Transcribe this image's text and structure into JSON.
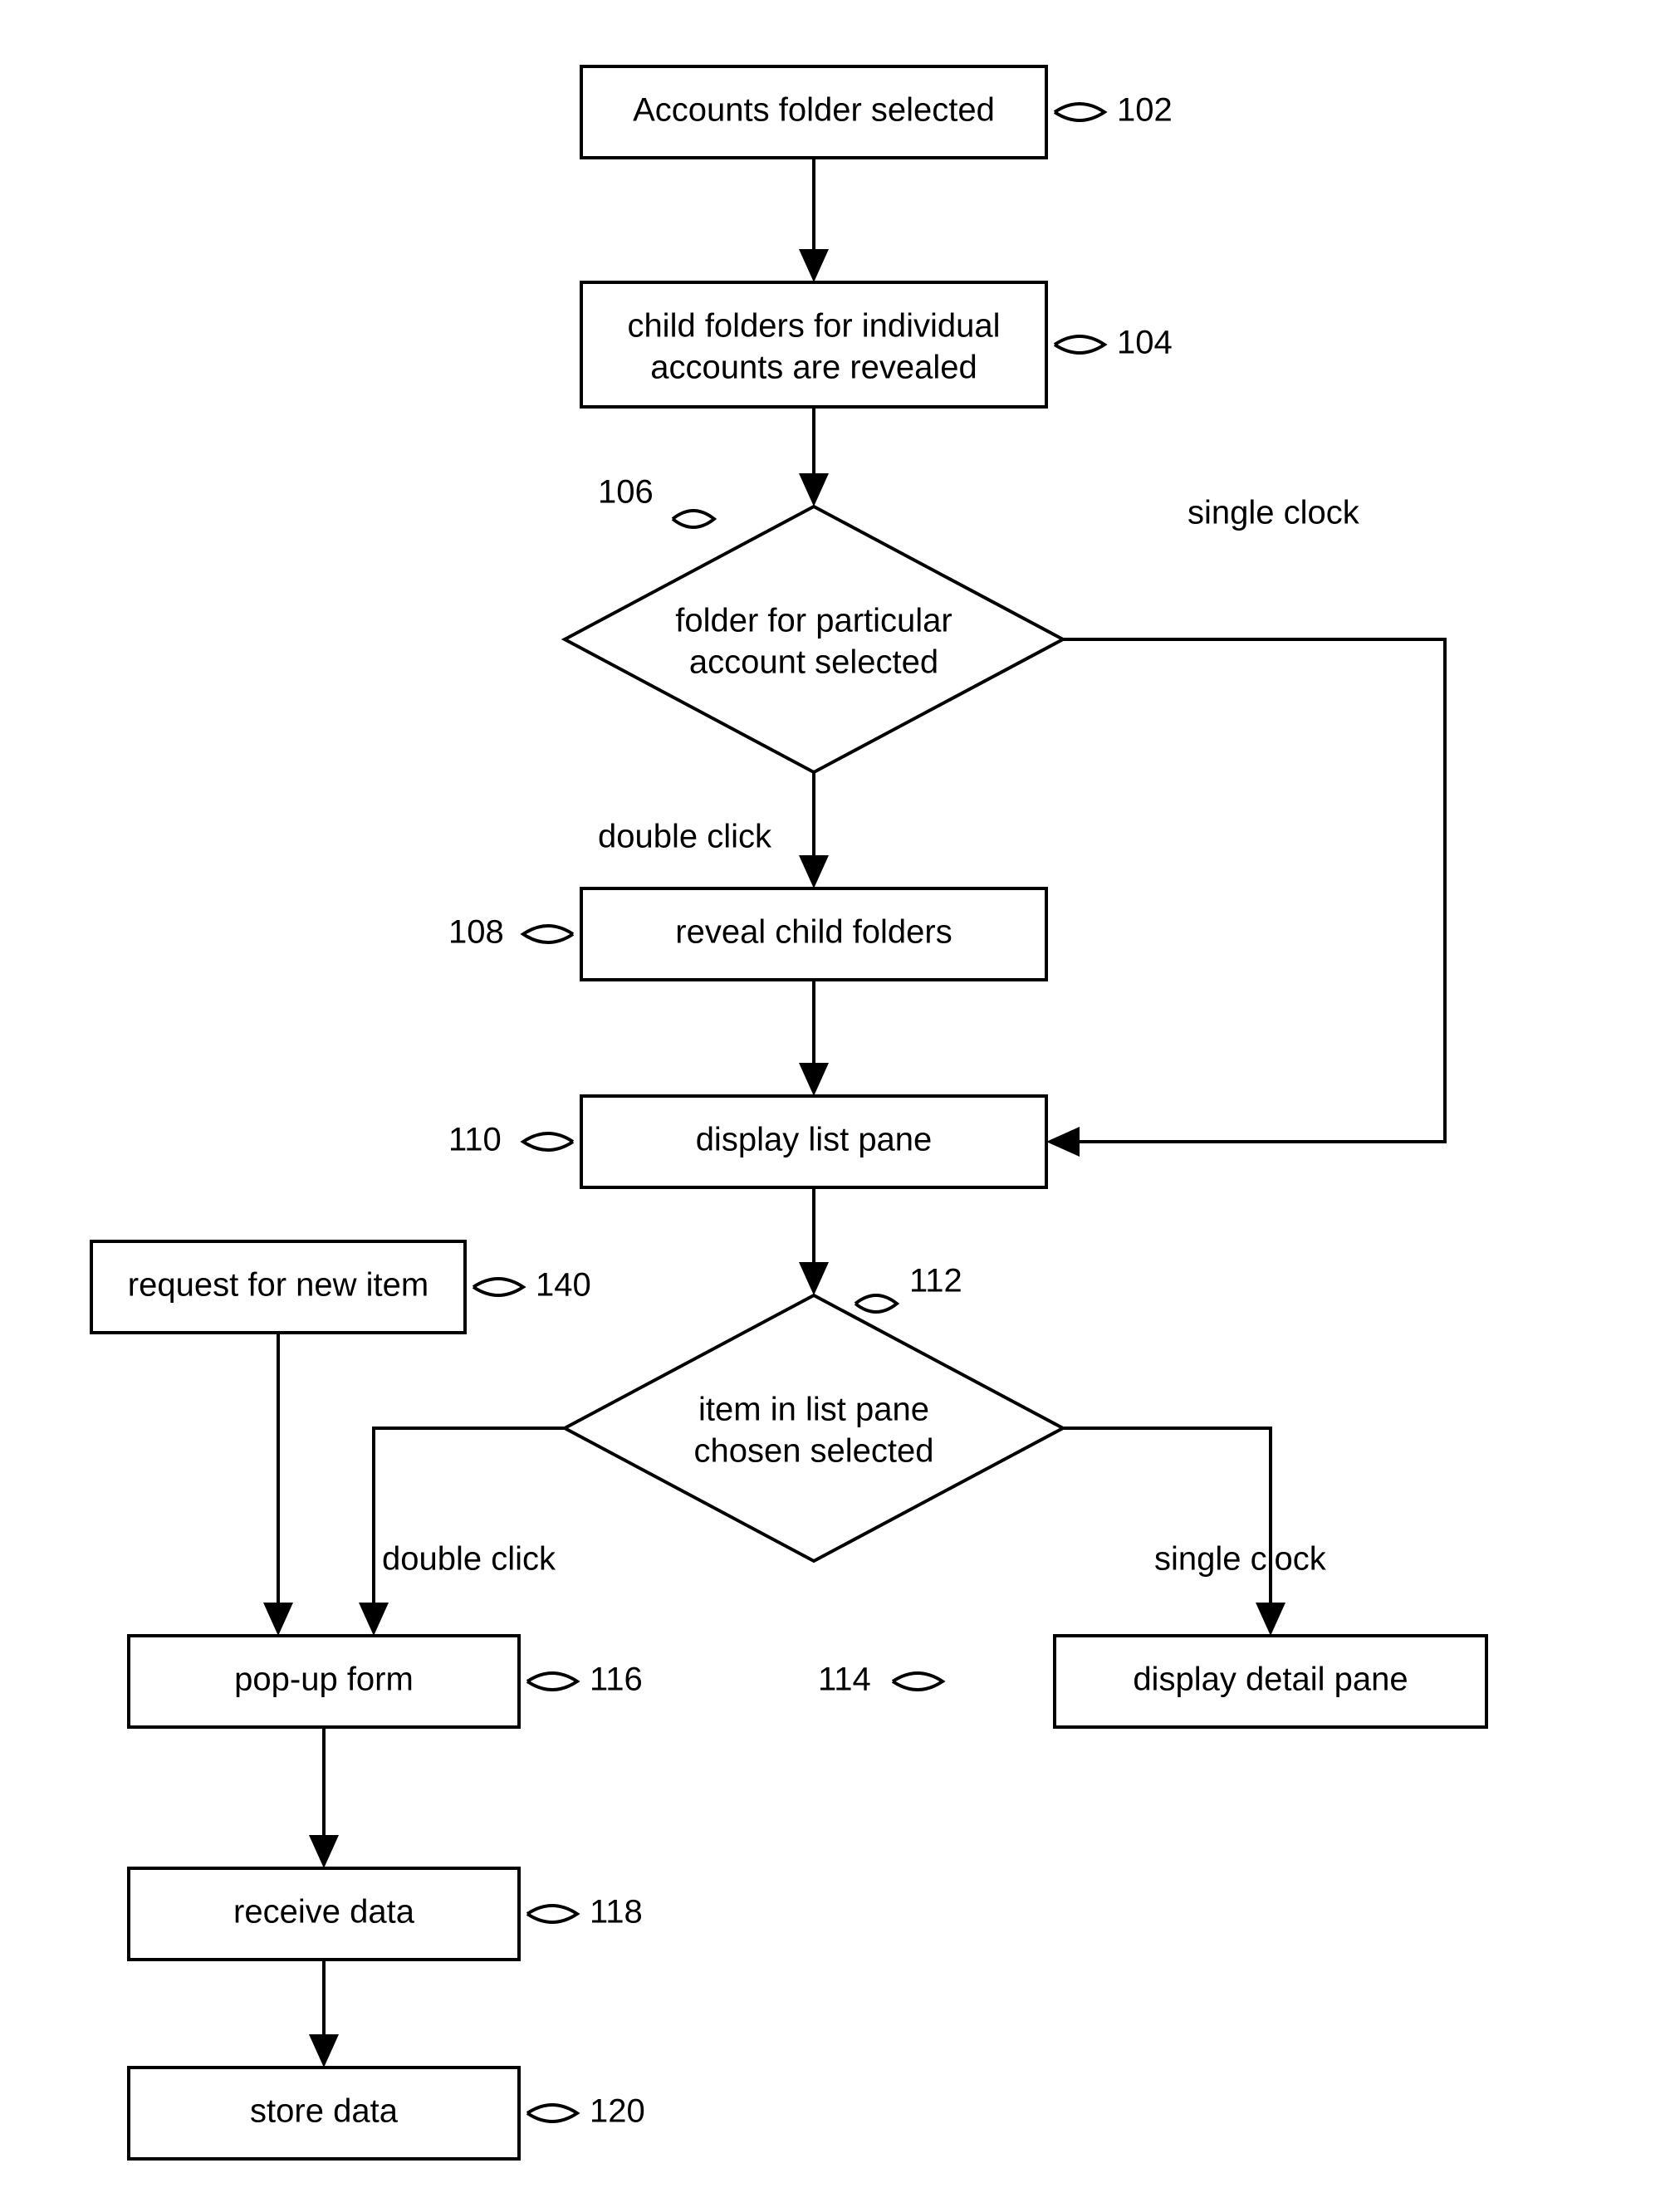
{
  "nodes": {
    "n102": {
      "label": "102",
      "text": "Accounts folder selected"
    },
    "n104": {
      "label": "104",
      "text_l1": "child folders for individual",
      "text_l2": "accounts are revealed"
    },
    "n106": {
      "label": "106",
      "text_l1": "folder for particular",
      "text_l2": "account selected"
    },
    "n108": {
      "label": "108",
      "text": "reveal child folders"
    },
    "n110": {
      "label": "110",
      "text": "display list pane"
    },
    "n112": {
      "label": "112",
      "text_l1": "item in list pane",
      "text_l2": "chosen selected"
    },
    "n114": {
      "label": "114",
      "text": "display detail pane"
    },
    "n116": {
      "label": "116",
      "text": "pop-up form"
    },
    "n118": {
      "label": "118",
      "text": "receive data"
    },
    "n120": {
      "label": "120",
      "text": "store data"
    },
    "n140": {
      "label": "140",
      "text": "request for new item"
    }
  },
  "edges": {
    "e106_right": "single clock",
    "e106_down": "double click",
    "e112_right": "single clock",
    "e112_left": "double click"
  }
}
